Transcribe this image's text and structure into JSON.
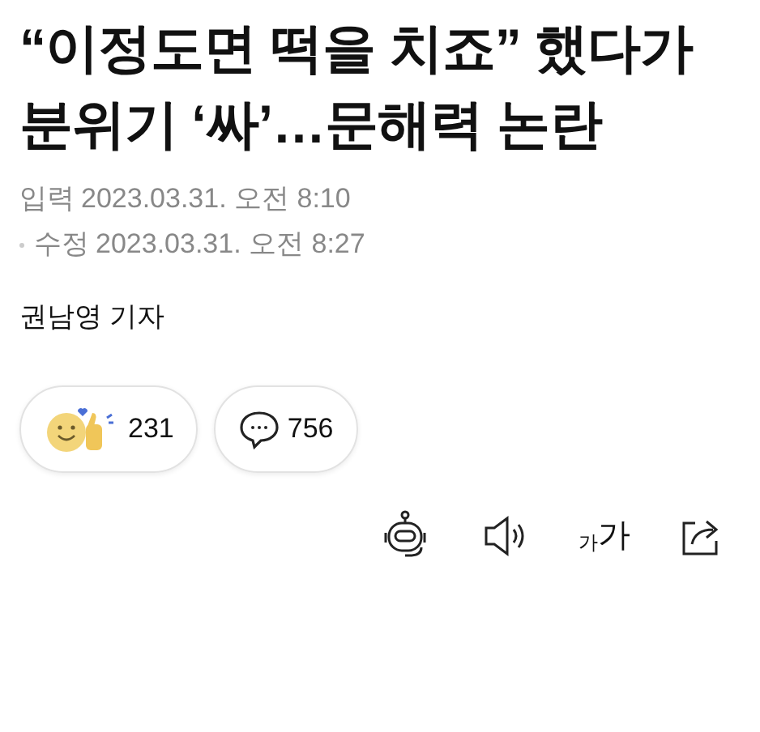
{
  "article": {
    "title": "“이정도면 떡을 치죠” 했다가 분위기 ‘싸’…문해력 논란",
    "dates": [
      {
        "label": "입력",
        "value": "2023.03.31. 오전 8:10",
        "bullet": false
      },
      {
        "label": "수정",
        "value": "2023.03.31. 오전 8:27",
        "bullet": true
      }
    ],
    "author": "권남영 기자"
  },
  "reactions": [
    {
      "kind": "like",
      "count": "231"
    },
    {
      "kind": "comment",
      "count": "756"
    }
  ],
  "toolbar": {
    "font_size_small": "가",
    "font_size_large": "가"
  }
}
